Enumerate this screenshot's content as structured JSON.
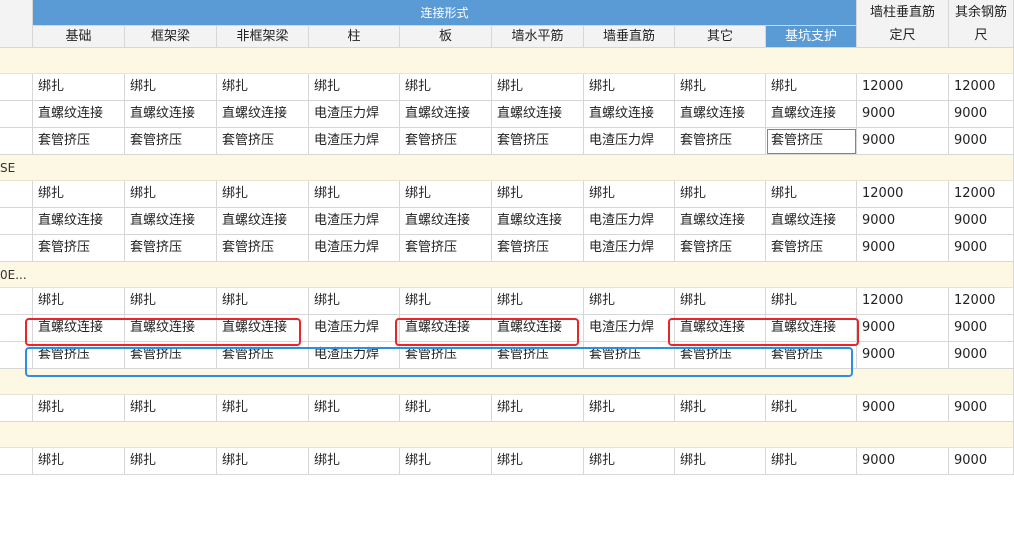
{
  "header": {
    "group_title": "连接形式",
    "columns": [
      "基础",
      "框架梁",
      "非框架梁",
      "柱",
      "板",
      "墙水平筋",
      "墙垂直筋",
      "其它",
      "基坑支护"
    ],
    "right_col1": [
      "墙柱垂直筋",
      "定尺"
    ],
    "right_col2": [
      "其余钢筋",
      "尺"
    ]
  },
  "group_labels": [
    "",
    "SE",
    "0E...",
    "",
    ""
  ],
  "groups": [
    {
      "rows": [
        [
          "绑扎",
          "绑扎",
          "绑扎",
          "绑扎",
          "绑扎",
          "绑扎",
          "绑扎",
          "绑扎",
          "绑扎",
          "12000",
          "12000"
        ],
        [
          "直螺纹连接",
          "直螺纹连接",
          "直螺纹连接",
          "电渣压力焊",
          "直螺纹连接",
          "直螺纹连接",
          "直螺纹连接",
          "直螺纹连接",
          "直螺纹连接",
          "9000",
          "9000"
        ],
        [
          "套管挤压",
          "套管挤压",
          "套管挤压",
          "电渣压力焊",
          "套管挤压",
          "套管挤压",
          "电渣压力焊",
          "套管挤压",
          "套管挤压",
          "9000",
          "9000"
        ]
      ]
    },
    {
      "rows": [
        [
          "绑扎",
          "绑扎",
          "绑扎",
          "绑扎",
          "绑扎",
          "绑扎",
          "绑扎",
          "绑扎",
          "绑扎",
          "12000",
          "12000"
        ],
        [
          "直螺纹连接",
          "直螺纹连接",
          "直螺纹连接",
          "电渣压力焊",
          "直螺纹连接",
          "直螺纹连接",
          "电渣压力焊",
          "直螺纹连接",
          "直螺纹连接",
          "9000",
          "9000"
        ],
        [
          "套管挤压",
          "套管挤压",
          "套管挤压",
          "电渣压力焊",
          "套管挤压",
          "套管挤压",
          "电渣压力焊",
          "套管挤压",
          "套管挤压",
          "9000",
          "9000"
        ]
      ]
    },
    {
      "rows": [
        [
          "绑扎",
          "绑扎",
          "绑扎",
          "绑扎",
          "绑扎",
          "绑扎",
          "绑扎",
          "绑扎",
          "绑扎",
          "12000",
          "12000"
        ],
        [
          "直螺纹连接",
          "直螺纹连接",
          "直螺纹连接",
          "电渣压力焊",
          "直螺纹连接",
          "直螺纹连接",
          "电渣压力焊",
          "直螺纹连接",
          "直螺纹连接",
          "9000",
          "9000"
        ],
        [
          "套管挤压",
          "套管挤压",
          "套管挤压",
          "电渣压力焊",
          "套管挤压",
          "套管挤压",
          "套管挤压",
          "套管挤压",
          "套管挤压",
          "9000",
          "9000"
        ]
      ]
    },
    {
      "rows": [
        [
          "绑扎",
          "绑扎",
          "绑扎",
          "绑扎",
          "绑扎",
          "绑扎",
          "绑扎",
          "绑扎",
          "绑扎",
          "9000",
          "9000"
        ]
      ]
    },
    {
      "rows": [
        [
          "绑扎",
          "绑扎",
          "绑扎",
          "绑扎",
          "绑扎",
          "绑扎",
          "绑扎",
          "绑扎",
          "绑扎",
          "9000",
          "9000"
        ]
      ]
    }
  ],
  "colors": {
    "header_blue": "#5b9bd5",
    "group_row": "#fdf8e3",
    "highlight_red": "#e8262a",
    "highlight_blue": "#2e8fe0"
  }
}
